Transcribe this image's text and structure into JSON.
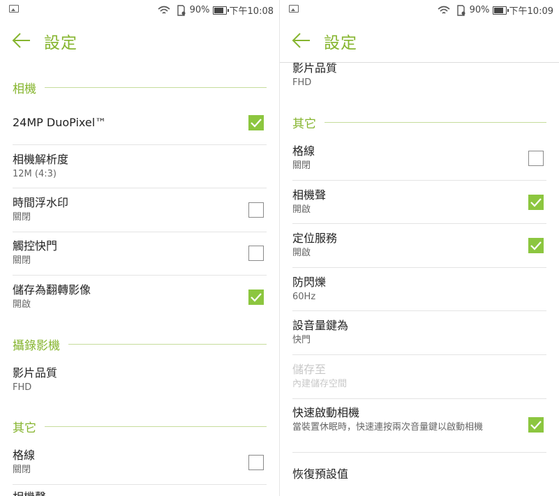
{
  "colors": {
    "accent": "#86b52f",
    "checkbox_on": "#8cc63f",
    "section_rule": "#c6dc9c"
  },
  "left": {
    "status": {
      "battery": "90%",
      "time": "下午10:08",
      "icons": [
        "image-icon",
        "wifi-icon",
        "sd-card-icon",
        "battery-icon"
      ]
    },
    "header": {
      "title": "設定",
      "back_icon": "back-arrow-icon"
    },
    "sections": {
      "camera": "相機",
      "video": "攝錄影機",
      "other": "其它"
    },
    "items": {
      "duopixel": {
        "title": "24MP DuoPixel™",
        "checked": true
      },
      "resolution": {
        "title": "相機解析度",
        "sub": "12M (4:3)"
      },
      "timestamp": {
        "title": "時間浮水印",
        "sub": "關閉",
        "checked": false
      },
      "touch_shutter": {
        "title": "觸控快門",
        "sub": "關閉",
        "checked": false
      },
      "mirror": {
        "title": "儲存為翻轉影像",
        "sub": "開啟",
        "checked": true
      },
      "video_quality": {
        "title": "影片品質",
        "sub": "FHD"
      },
      "grid": {
        "title": "格線",
        "sub": "關閉",
        "checked": false
      },
      "camera_sound_partial": {
        "title": "相機聲"
      }
    }
  },
  "right": {
    "status": {
      "battery": "90%",
      "time": "下午10:09",
      "icons": [
        "image-icon",
        "wifi-icon",
        "sd-card-icon",
        "battery-icon"
      ]
    },
    "header": {
      "title": "設定",
      "back_icon": "back-arrow-icon"
    },
    "sections": {
      "other": "其它"
    },
    "items": {
      "video_quality": {
        "title": "影片品質",
        "sub": "FHD"
      },
      "grid": {
        "title": "格線",
        "sub": "關閉",
        "checked": false
      },
      "camera_sound": {
        "title": "相機聲",
        "sub": "開啟",
        "checked": true
      },
      "location": {
        "title": "定位服務",
        "sub": "開啟",
        "checked": true
      },
      "antiflicker": {
        "title": "防閃爍",
        "sub": "60Hz"
      },
      "volume_key": {
        "title": "設音量鍵為",
        "sub": "快門"
      },
      "storage": {
        "title": "儲存至",
        "sub": "內建儲存空間",
        "disabled": true
      },
      "quick_launch": {
        "title": "快速啟動相機",
        "sub": "當裝置休眠時，快速連按兩次音量鍵以啟動相機",
        "checked": true
      },
      "reset": {
        "title": "恢復預設值"
      }
    }
  }
}
